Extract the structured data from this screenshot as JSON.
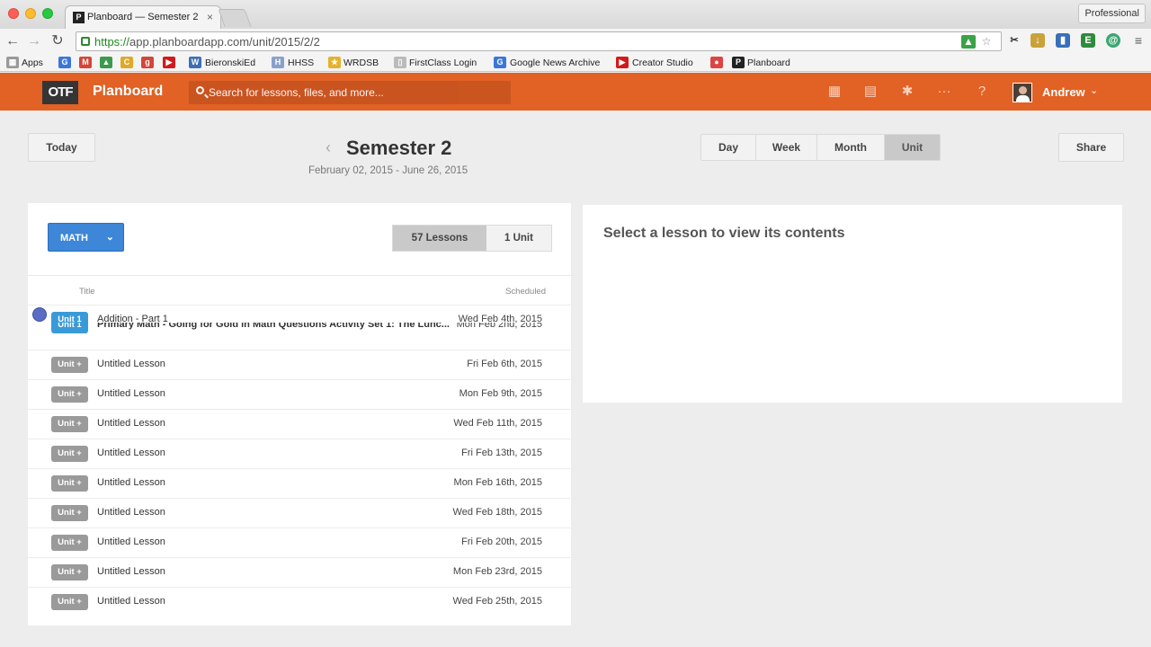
{
  "browser": {
    "tab_title": "Planboard — Semester 2",
    "tab_close": "×",
    "profile": "Professional",
    "url_scheme": "https://",
    "url_rest": "app.planboardapp.com/unit/2015/2/2",
    "bookmarks": [
      "Apps",
      "BieronskiEd",
      "HHSS",
      "WRDSB",
      "FirstClass Login",
      "Google News Archive",
      "Creator Studio",
      "Planboard"
    ]
  },
  "app": {
    "logo": "OTF",
    "brand": "Planboard",
    "search_placeholder": "Search for lessons, files, and more...",
    "user": "Andrew"
  },
  "toolbar": {
    "today": "Today",
    "share": "Share",
    "title": "Semester 2",
    "dates": "February 02, 2015 - June 26, 2015",
    "views": [
      "Day",
      "Week",
      "Month",
      "Unit"
    ],
    "active_view": "Unit"
  },
  "lessons_panel": {
    "subject": "MATH",
    "counts": [
      "57 Lessons",
      "1 Unit"
    ],
    "col_title": "Title",
    "col_scheduled": "Scheduled",
    "rows": [
      {
        "badge": "Unit 1",
        "title": "Addition - Part 1",
        "date": "Wed Feb 4th, 2015"
      },
      {
        "badge": "Unit 1",
        "title": "Primary Math - Going for Gold in Math Questions Activity Set 1: The Lunc...",
        "date": "Mon Feb 2nd, 2015"
      },
      {
        "badge": "Unit +",
        "title": "Untitled Lesson",
        "date": "Fri Feb 6th, 2015"
      },
      {
        "badge": "Unit +",
        "title": "Untitled Lesson",
        "date": "Mon Feb 9th, 2015"
      },
      {
        "badge": "Unit +",
        "title": "Untitled Lesson",
        "date": "Wed Feb 11th, 2015"
      },
      {
        "badge": "Unit +",
        "title": "Untitled Lesson",
        "date": "Fri Feb 13th, 2015"
      },
      {
        "badge": "Unit +",
        "title": "Untitled Lesson",
        "date": "Mon Feb 16th, 2015"
      },
      {
        "badge": "Unit +",
        "title": "Untitled Lesson",
        "date": "Wed Feb 18th, 2015"
      },
      {
        "badge": "Unit +",
        "title": "Untitled Lesson",
        "date": "Fri Feb 20th, 2015"
      },
      {
        "badge": "Unit +",
        "title": "Untitled Lesson",
        "date": "Mon Feb 23rd, 2015"
      },
      {
        "badge": "Unit +",
        "title": "Untitled Lesson",
        "date": "Wed Feb 25th, 2015"
      }
    ]
  },
  "content_panel": {
    "message": "Select a lesson to view its contents"
  },
  "colors": {
    "brand_orange": "#e26124",
    "unit_blue": "#3a9ad9",
    "unit_gray": "#9a9a9a",
    "math_blue": "#3d86d8"
  }
}
